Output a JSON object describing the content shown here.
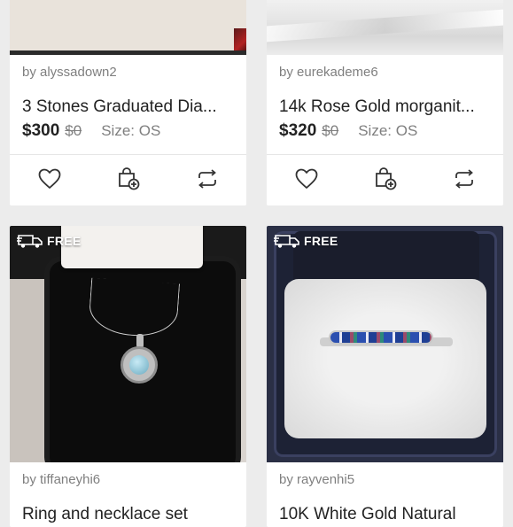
{
  "listings": [
    {
      "seller": "by alyssadown2",
      "title": "3 Stones Graduated Dia...",
      "price": "$300",
      "original_price": "$0",
      "size": "Size: OS"
    },
    {
      "seller": "by eurekademe6",
      "title": "14k Rose Gold morganit...",
      "price": "$320",
      "original_price": "$0",
      "size": "Size: OS"
    },
    {
      "badge": "FREE",
      "seller": "by tiffaneyhi6",
      "title": "Ring and necklace set"
    },
    {
      "badge": "FREE",
      "seller": "by rayvenhi5",
      "title": "10K White Gold Natural"
    }
  ],
  "icons": {
    "like": "heart-icon",
    "bundle": "bag-plus-icon",
    "share": "share-icon",
    "shipping": "truck-icon"
  },
  "colors": {
    "background": "#ececec",
    "text": "#222222",
    "muted": "#7f7f7f"
  }
}
